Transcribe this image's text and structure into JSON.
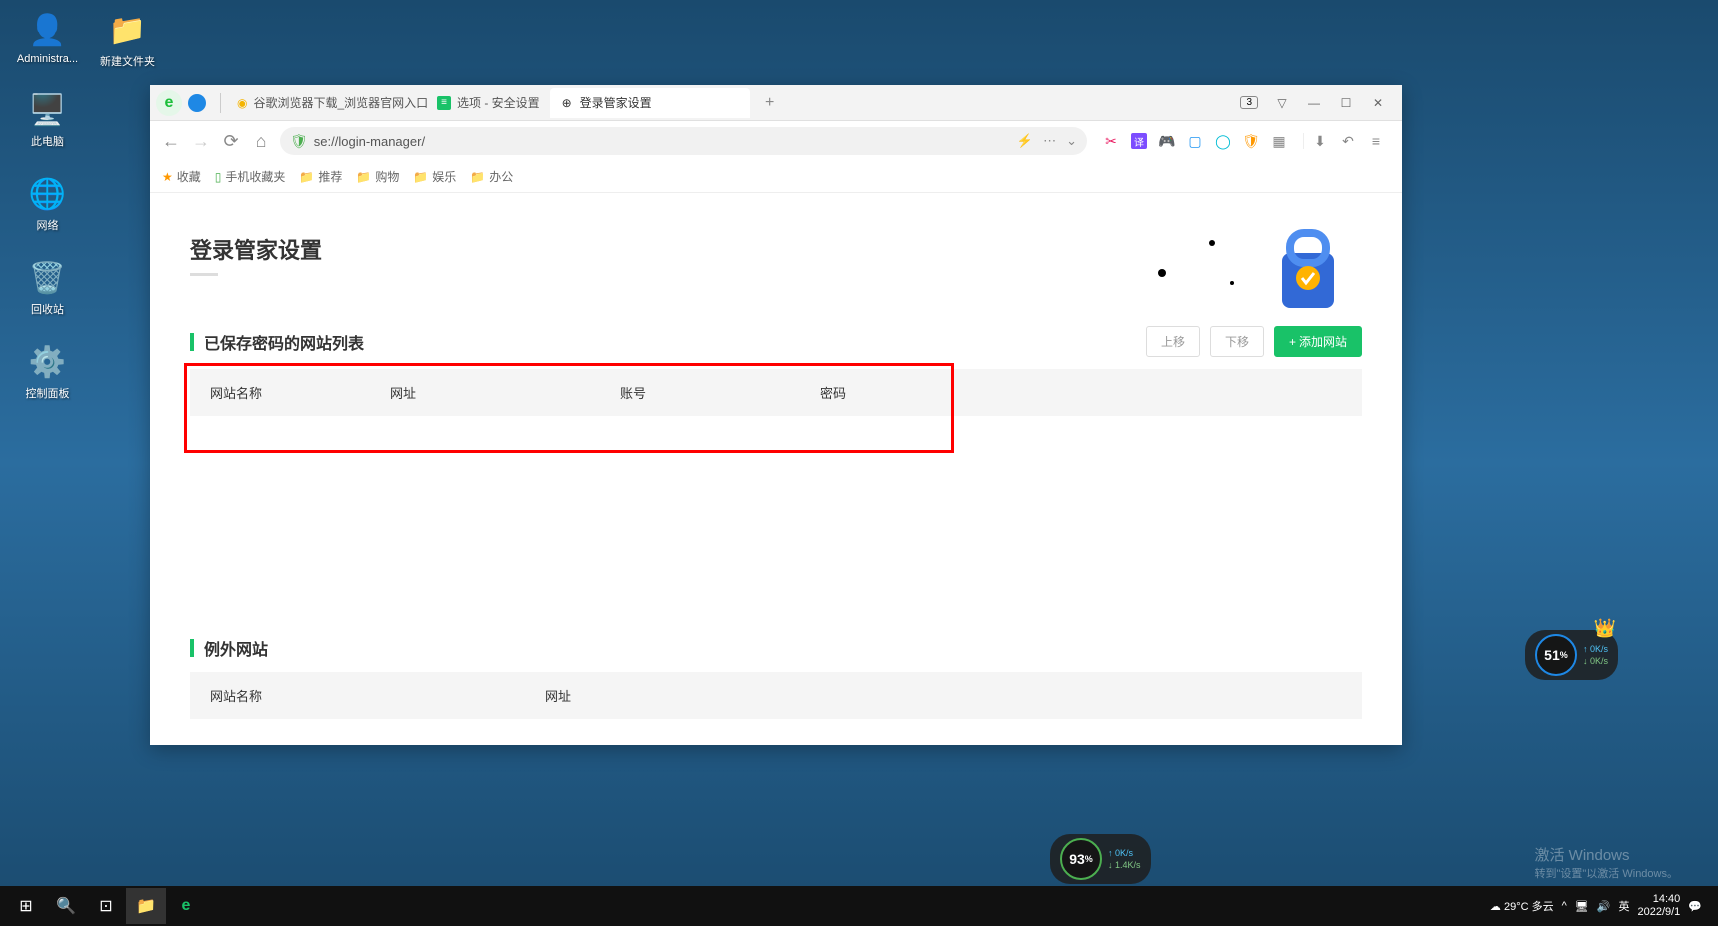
{
  "desktop": {
    "icons": [
      {
        "label": "Administra..."
      },
      {
        "label": "此电脑"
      },
      {
        "label": "网络"
      },
      {
        "label": "回收站"
      },
      {
        "label": "控制面板"
      }
    ],
    "col2": {
      "label": "新建文件夹"
    }
  },
  "tabs": {
    "tab1": "谷歌浏览器下载_浏览器官网入口",
    "tab2": "选项 - 安全设置",
    "tab3": "登录管家设置",
    "badge": "3"
  },
  "address": {
    "url": "se://login-manager/"
  },
  "bookmarks": {
    "fav": "收藏",
    "mobile": "手机收藏夹",
    "rec": "推荐",
    "shop": "购物",
    "ent": "娱乐",
    "office": "办公"
  },
  "page": {
    "title": "登录管家设置",
    "section1": {
      "title": "已保存密码的网站列表",
      "btn_up": "上移",
      "btn_down": "下移",
      "btn_add": "添加网站",
      "cols": {
        "name": "网站名称",
        "url": "网址",
        "account": "账号",
        "password": "密码"
      }
    },
    "section2": {
      "title": "例外网站",
      "cols": {
        "name": "网站名称",
        "url": "网址"
      }
    }
  },
  "widgets": {
    "w1": {
      "pct": "51",
      "unit": "%",
      "up": "0K/s",
      "down": "0K/s"
    },
    "w2": {
      "pct": "93",
      "unit": "%",
      "up": "0K/s",
      "down": "1.4K/s"
    }
  },
  "watermark": {
    "line1": "激活 Windows",
    "line2": "转到\"设置\"以激活 Windows。"
  },
  "taskbar": {
    "weather": "29°C 多云",
    "ime": "英",
    "time": "14:40",
    "date": "2022/9/1"
  }
}
